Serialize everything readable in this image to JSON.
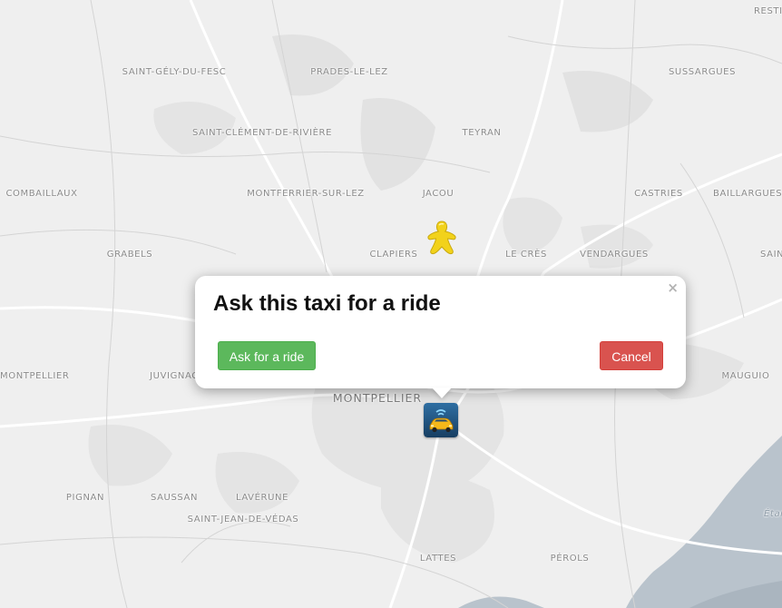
{
  "places": [
    {
      "id": "restinclieres",
      "label": "RESTI"
    },
    {
      "id": "saint-gely",
      "label": "SAINT-GÉLY-DU-FESC"
    },
    {
      "id": "prades",
      "label": "PRADES-LE-LEZ"
    },
    {
      "id": "sussargues",
      "label": "SUSSARGUES"
    },
    {
      "id": "saint-clement",
      "label": "SAINT-CLÉMENT-DE-RIVIÈRE"
    },
    {
      "id": "teyran",
      "label": "TEYRAN"
    },
    {
      "id": "combaillaux",
      "label": "COMBAILLAUX"
    },
    {
      "id": "montferrier",
      "label": "MONTFERRIER-SUR-LEZ"
    },
    {
      "id": "jacou",
      "label": "JACOU"
    },
    {
      "id": "castries",
      "label": "CASTRIES"
    },
    {
      "id": "baillargues",
      "label": "BAILLARGUES"
    },
    {
      "id": "grabels",
      "label": "GRABELS"
    },
    {
      "id": "clapiers",
      "label": "CLAPIERS"
    },
    {
      "id": "le-cres",
      "label": "LE CRÈS"
    },
    {
      "id": "vendargues",
      "label": "VENDARGUES"
    },
    {
      "id": "saint-aunes",
      "label": "SAIN"
    },
    {
      "id": "montpellier-left",
      "label": "MONTPELLIER"
    },
    {
      "id": "juvignac",
      "label": "JUVIGNAC"
    },
    {
      "id": "mauguio",
      "label": "MAUGUIO"
    },
    {
      "id": "montpellier",
      "label": "MONTPELLIER"
    },
    {
      "id": "pignan",
      "label": "PIGNAN"
    },
    {
      "id": "saussan",
      "label": "SAUSSAN"
    },
    {
      "id": "laverune",
      "label": "LAVÉRUNE"
    },
    {
      "id": "saint-jean",
      "label": "SAINT-JEAN-DE-VÉDAS"
    },
    {
      "id": "lattes",
      "label": "LATTES"
    },
    {
      "id": "perols",
      "label": "PÉROLS"
    },
    {
      "id": "etang",
      "label": "Étan"
    }
  ],
  "markers": {
    "user": {
      "icon": "meeple-icon",
      "color": "#f2d21b"
    },
    "taxi": {
      "icon": "taxi-icon",
      "color": "#1d4f7a"
    }
  },
  "popup": {
    "title": "Ask this taxi for a ride",
    "close_label": "×",
    "ask_label": "Ask for a ride",
    "cancel_label": "Cancel"
  },
  "colors": {
    "map_bg": "#efefef",
    "water": "#b9c3cc",
    "ask_button": "#5cb85c",
    "cancel_button": "#d9534f"
  }
}
